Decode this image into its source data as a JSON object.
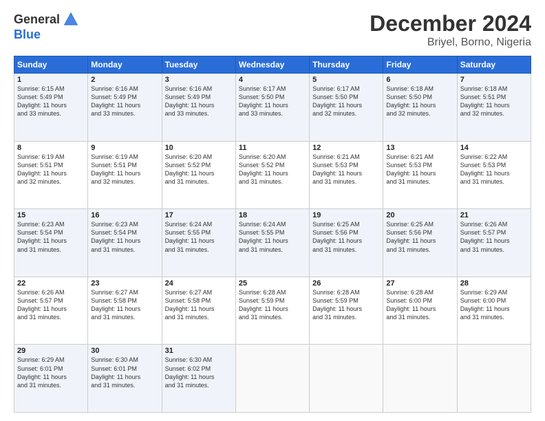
{
  "logo": {
    "general": "General",
    "blue": "Blue"
  },
  "title": "December 2024",
  "location": "Briyel, Borno, Nigeria",
  "days_header": [
    "Sunday",
    "Monday",
    "Tuesday",
    "Wednesday",
    "Thursday",
    "Friday",
    "Saturday"
  ],
  "weeks": [
    [
      {
        "day": "1",
        "info": "Sunrise: 6:15 AM\nSunset: 5:49 PM\nDaylight: 11 hours\nand 33 minutes."
      },
      {
        "day": "2",
        "info": "Sunrise: 6:16 AM\nSunset: 5:49 PM\nDaylight: 11 hours\nand 33 minutes."
      },
      {
        "day": "3",
        "info": "Sunrise: 6:16 AM\nSunset: 5:49 PM\nDaylight: 11 hours\nand 33 minutes."
      },
      {
        "day": "4",
        "info": "Sunrise: 6:17 AM\nSunset: 5:50 PM\nDaylight: 11 hours\nand 33 minutes."
      },
      {
        "day": "5",
        "info": "Sunrise: 6:17 AM\nSunset: 5:50 PM\nDaylight: 11 hours\nand 32 minutes."
      },
      {
        "day": "6",
        "info": "Sunrise: 6:18 AM\nSunset: 5:50 PM\nDaylight: 11 hours\nand 32 minutes."
      },
      {
        "day": "7",
        "info": "Sunrise: 6:18 AM\nSunset: 5:51 PM\nDaylight: 11 hours\nand 32 minutes."
      }
    ],
    [
      {
        "day": "8",
        "info": "Sunrise: 6:19 AM\nSunset: 5:51 PM\nDaylight: 11 hours\nand 32 minutes."
      },
      {
        "day": "9",
        "info": "Sunrise: 6:19 AM\nSunset: 5:51 PM\nDaylight: 11 hours\nand 32 minutes."
      },
      {
        "day": "10",
        "info": "Sunrise: 6:20 AM\nSunset: 5:52 PM\nDaylight: 11 hours\nand 31 minutes."
      },
      {
        "day": "11",
        "info": "Sunrise: 6:20 AM\nSunset: 5:52 PM\nDaylight: 11 hours\nand 31 minutes."
      },
      {
        "day": "12",
        "info": "Sunrise: 6:21 AM\nSunset: 5:53 PM\nDaylight: 11 hours\nand 31 minutes."
      },
      {
        "day": "13",
        "info": "Sunrise: 6:21 AM\nSunset: 5:53 PM\nDaylight: 11 hours\nand 31 minutes."
      },
      {
        "day": "14",
        "info": "Sunrise: 6:22 AM\nSunset: 5:53 PM\nDaylight: 11 hours\nand 31 minutes."
      }
    ],
    [
      {
        "day": "15",
        "info": "Sunrise: 6:23 AM\nSunset: 5:54 PM\nDaylight: 11 hours\nand 31 minutes."
      },
      {
        "day": "16",
        "info": "Sunrise: 6:23 AM\nSunset: 5:54 PM\nDaylight: 11 hours\nand 31 minutes."
      },
      {
        "day": "17",
        "info": "Sunrise: 6:24 AM\nSunset: 5:55 PM\nDaylight: 11 hours\nand 31 minutes."
      },
      {
        "day": "18",
        "info": "Sunrise: 6:24 AM\nSunset: 5:55 PM\nDaylight: 11 hours\nand 31 minutes."
      },
      {
        "day": "19",
        "info": "Sunrise: 6:25 AM\nSunset: 5:56 PM\nDaylight: 11 hours\nand 31 minutes."
      },
      {
        "day": "20",
        "info": "Sunrise: 6:25 AM\nSunset: 5:56 PM\nDaylight: 11 hours\nand 31 minutes."
      },
      {
        "day": "21",
        "info": "Sunrise: 6:26 AM\nSunset: 5:57 PM\nDaylight: 11 hours\nand 31 minutes."
      }
    ],
    [
      {
        "day": "22",
        "info": "Sunrise: 6:26 AM\nSunset: 5:57 PM\nDaylight: 11 hours\nand 31 minutes."
      },
      {
        "day": "23",
        "info": "Sunrise: 6:27 AM\nSunset: 5:58 PM\nDaylight: 11 hours\nand 31 minutes."
      },
      {
        "day": "24",
        "info": "Sunrise: 6:27 AM\nSunset: 5:58 PM\nDaylight: 11 hours\nand 31 minutes."
      },
      {
        "day": "25",
        "info": "Sunrise: 6:28 AM\nSunset: 5:59 PM\nDaylight: 11 hours\nand 31 minutes."
      },
      {
        "day": "26",
        "info": "Sunrise: 6:28 AM\nSunset: 5:59 PM\nDaylight: 11 hours\nand 31 minutes."
      },
      {
        "day": "27",
        "info": "Sunrise: 6:28 AM\nSunset: 6:00 PM\nDaylight: 11 hours\nand 31 minutes."
      },
      {
        "day": "28",
        "info": "Sunrise: 6:29 AM\nSunset: 6:00 PM\nDaylight: 11 hours\nand 31 minutes."
      }
    ],
    [
      {
        "day": "29",
        "info": "Sunrise: 6:29 AM\nSunset: 6:01 PM\nDaylight: 11 hours\nand 31 minutes."
      },
      {
        "day": "30",
        "info": "Sunrise: 6:30 AM\nSunset: 6:01 PM\nDaylight: 11 hours\nand 31 minutes."
      },
      {
        "day": "31",
        "info": "Sunrise: 6:30 AM\nSunset: 6:02 PM\nDaylight: 11 hours\nand 31 minutes."
      },
      {
        "day": "",
        "info": ""
      },
      {
        "day": "",
        "info": ""
      },
      {
        "day": "",
        "info": ""
      },
      {
        "day": "",
        "info": ""
      }
    ]
  ]
}
